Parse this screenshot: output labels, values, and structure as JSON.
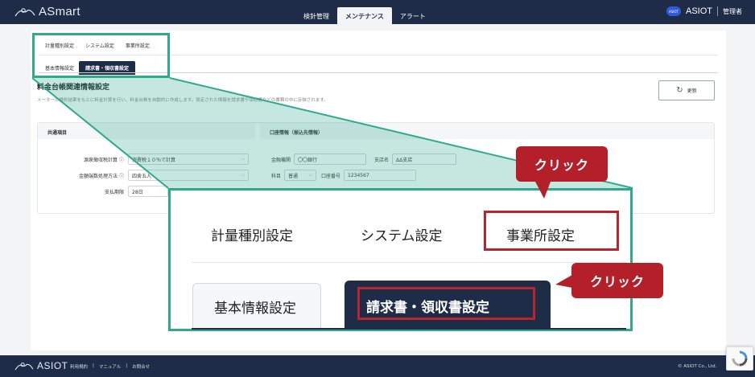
{
  "header": {
    "logo_text": "ASmart",
    "nav_tabs": [
      {
        "label": "検針管理"
      },
      {
        "label": "メンテナンス"
      },
      {
        "label": "アラート"
      }
    ],
    "company_name": "ASIOT",
    "badge_text": "ASIOT",
    "user_role": "管理者"
  },
  "sub_tabs": [
    "計量種別設定",
    "システム設定",
    "事業所設定"
  ],
  "sub_tabs2": [
    "基本情報設定",
    "請求書・領収書設定"
  ],
  "section": {
    "title": "料金台帳関連情報設定",
    "description": "メーターの検針結果をもとに料金計算を行い、料金台帳を自動的に作成します。設定された情報を請求書や領収書などの書類の中に反映されます。",
    "update_button": "更新"
  },
  "common": {
    "heading": "共通項目",
    "rows": [
      {
        "label": "源泉徴収税計算",
        "value": "消費税１０％で計算"
      },
      {
        "label": "金額端数処理方法",
        "value": "四舍五入"
      },
      {
        "label": "支払期限",
        "value": "28日"
      }
    ]
  },
  "account": {
    "heading": "口座情報（振込先情報）",
    "bank_label": "金融機関",
    "bank_value": "〇〇銀行",
    "branch_label": "支店名",
    "branch_value": "ΔΔ支店",
    "type_label": "科目",
    "type_value": "普通",
    "number_label": "口座番号",
    "number_value": "1234567"
  },
  "zoom": {
    "tabs": [
      "計量種別設定",
      "システム設定",
      "事業所設定"
    ],
    "tabs2": [
      "基本情報設定",
      "請求書・領収書設定"
    ]
  },
  "callouts": {
    "click1": "クリック",
    "click2": "クリック"
  },
  "footer": {
    "logo_text": "ASIOT",
    "links": [
      "利用規約",
      "|",
      "マニュアル",
      "|",
      "お問合せ"
    ],
    "copyright": "© ASIOT Co., Ltd."
  },
  "colors": {
    "navy": "#1e2c48",
    "highlight_green": "#2fa88d",
    "highlight_red": "#b8252e",
    "callout_red": "#b3202a"
  }
}
